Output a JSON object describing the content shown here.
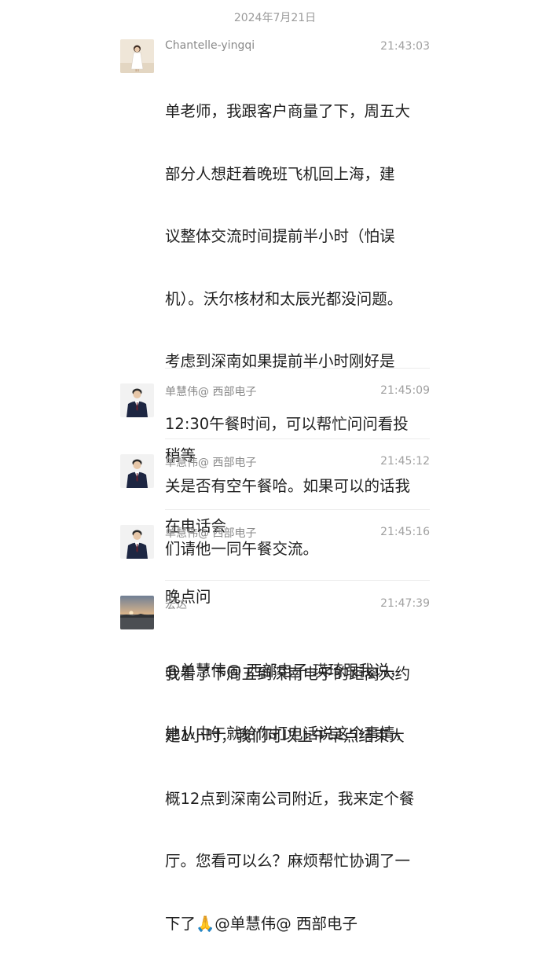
{
  "date_header": "2024年7月21日",
  "messages": [
    {
      "sender": "Chantelle-yingqi",
      "time": "21:43:03",
      "avatar": "woman-white-dress-avatar",
      "lines": [
        "单老师，我跟客户商量了下，周五大",
        "部分人想赶着晚班飞机回上海，建",
        "议整体交流时间提前半小时（怕误",
        "机）。沃尔核材和太辰光都没问题。",
        "考虑到深南如果提前半小时刚好是",
        "12:30午餐时间，可以帮忙问问看投",
        "关是否有空午餐哈。如果可以的话我",
        "们请他一同午餐交流。",
        "",
        "我看了下周五到深南电子的距离大约",
        "是1小时，我们可以上午早点结束大",
        "概12点到深南公司附近，我来定个餐",
        "厅。您看可以么？麻烦帮忙协调了一",
        "下了🙏@单慧伟@ 西部电子"
      ]
    },
    {
      "sender": "单慧伟@ 西部电子",
      "time": "21:45:09",
      "avatar": "man-suit-avatar",
      "lines": [
        "稍等"
      ]
    },
    {
      "sender": "单慧伟@ 西部电子",
      "time": "21:45:12",
      "avatar": "man-suit-avatar",
      "lines": [
        "在电话会"
      ]
    },
    {
      "sender": "单慧伟@ 西部电子",
      "time": "21:45:16",
      "avatar": "man-suit-avatar",
      "lines": [
        "晚点问"
      ]
    },
    {
      "sender": "宏达",
      "time": "21:47:39",
      "avatar": "sunset-landscape-avatar",
      "lines": [
        "@单慧伟@ 西部电子 瑛琦跟我说，",
        "她从中午就给你打电话说这个事情，"
      ]
    }
  ]
}
